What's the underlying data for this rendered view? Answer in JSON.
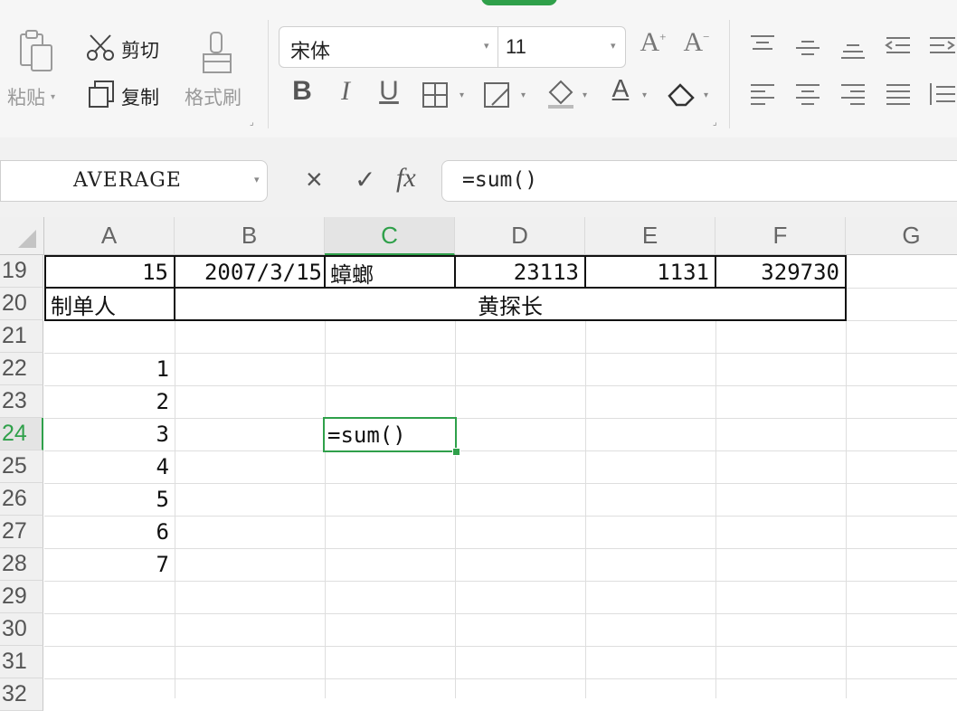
{
  "ribbon": {
    "paste_label": "粘贴",
    "cut_label": "剪切",
    "copy_label": "复制",
    "format_painter_label": "格式刷",
    "font_name": "宋体",
    "font_size": "11",
    "increase_font": "A",
    "decrease_font": "A",
    "bold": "B",
    "italic": "I",
    "underline": "U",
    "font_color_letter": "A"
  },
  "formula_bar": {
    "name_box": "AVERAGE",
    "cancel": "×",
    "confirm": "✓",
    "fx": "fx",
    "formula": "=sum()"
  },
  "grid": {
    "columns": [
      "A",
      "B",
      "C",
      "D",
      "E",
      "F",
      "G"
    ],
    "rows": [
      "19",
      "20",
      "21",
      "22",
      "23",
      "24",
      "25",
      "26",
      "27",
      "28",
      "29",
      "30",
      "31",
      "32"
    ],
    "active_column": "C",
    "active_row": "24",
    "cells": {
      "A19": "15",
      "B19": "2007/3/15",
      "C19": "蟑螂",
      "D19": "23113",
      "E19": "1131",
      "F19": "329730",
      "A20": "制单人",
      "B20": "黄探长",
      "A22": "1",
      "A23": "2",
      "A24": "3",
      "A25": "4",
      "A26": "5",
      "A27": "6",
      "A28": "7",
      "C24": "=sum()"
    }
  },
  "colors": {
    "accent": "#2fa04a",
    "header_bg": "#f0f0f0",
    "ribbon_bg": "#f6f6f6"
  }
}
